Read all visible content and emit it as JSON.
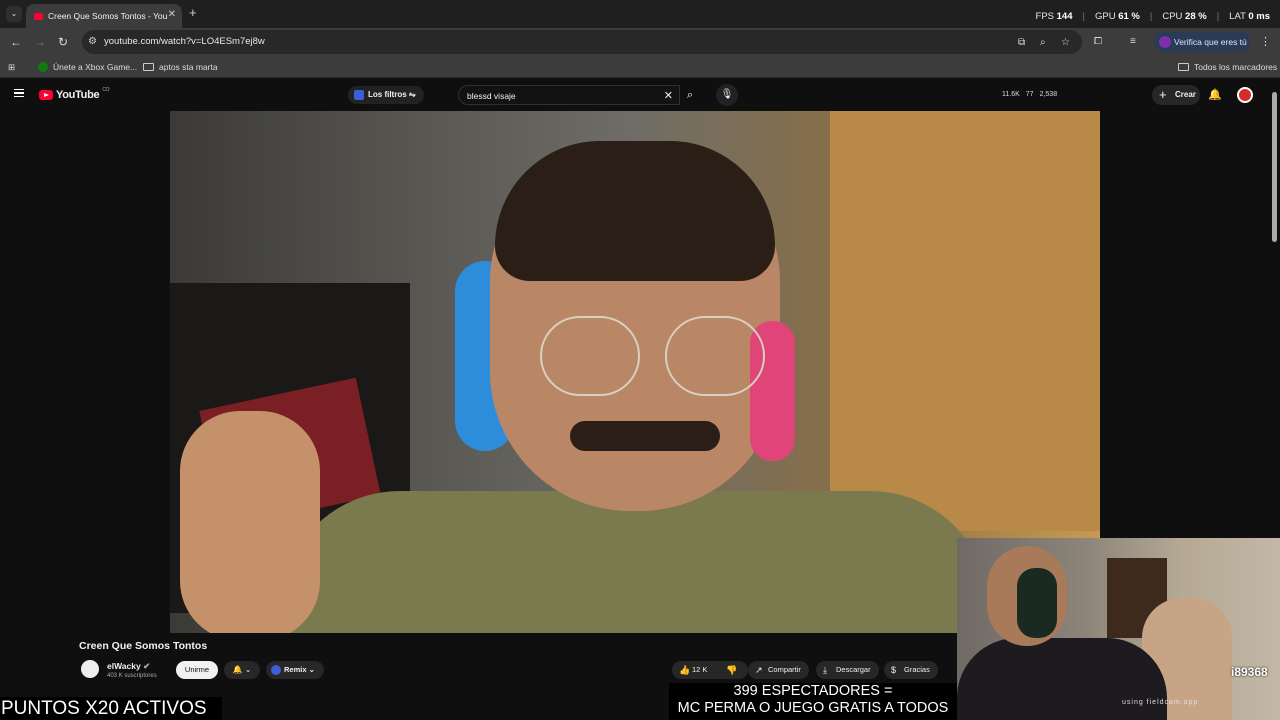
{
  "browser": {
    "tab_title": "Creen Que Somos Tontos - You",
    "url": "youtube.com/watch?v=LO4ESm7ej8w",
    "verify_label": "Verifica que eres tú",
    "bookmarks": [
      "Únete a Xbox Game...",
      "aptos sta marta"
    ],
    "all_bookmarks_label": "Todos los marcadores"
  },
  "overlay_stats": {
    "fps_label": "FPS",
    "fps_value": "144",
    "gpu_label": "GPU",
    "gpu_value": "61 %",
    "cpu_label": "CPU",
    "cpu_value": "28 %",
    "lat_label": "LAT",
    "lat_value": "0 ms"
  },
  "youtube": {
    "logo_text": "YouTube",
    "logo_cc": "CO",
    "filters_label": "Los filtros",
    "search_value": "blessd visaje",
    "header_stats": [
      "11.6K",
      "77",
      "2,538"
    ],
    "create_label": "Crear",
    "video_title": "Creen Que Somos Tontos",
    "channel_name": "elWacky",
    "subscribers": "403 K suscriptores",
    "join_label": "Unirme",
    "remix_label": "Remix",
    "likes": "12 K",
    "share_label": "Compartir",
    "download_label": "Descargar",
    "thanks_label": "Gracias"
  },
  "stream_overlay": {
    "points_text": "PUNTOS X20 ACTIVOS",
    "viewers_line1": "399 ESPECTADORES =",
    "viewers_line2": "MC PERMA O JUEGO GRATIS A TODOS",
    "webcam_count": "i89368",
    "webcam_watermark": "using fieldcam.app"
  },
  "colors": {
    "yt_red": "#ff0033",
    "background": "#0f0f0f",
    "chip": "#272727"
  }
}
